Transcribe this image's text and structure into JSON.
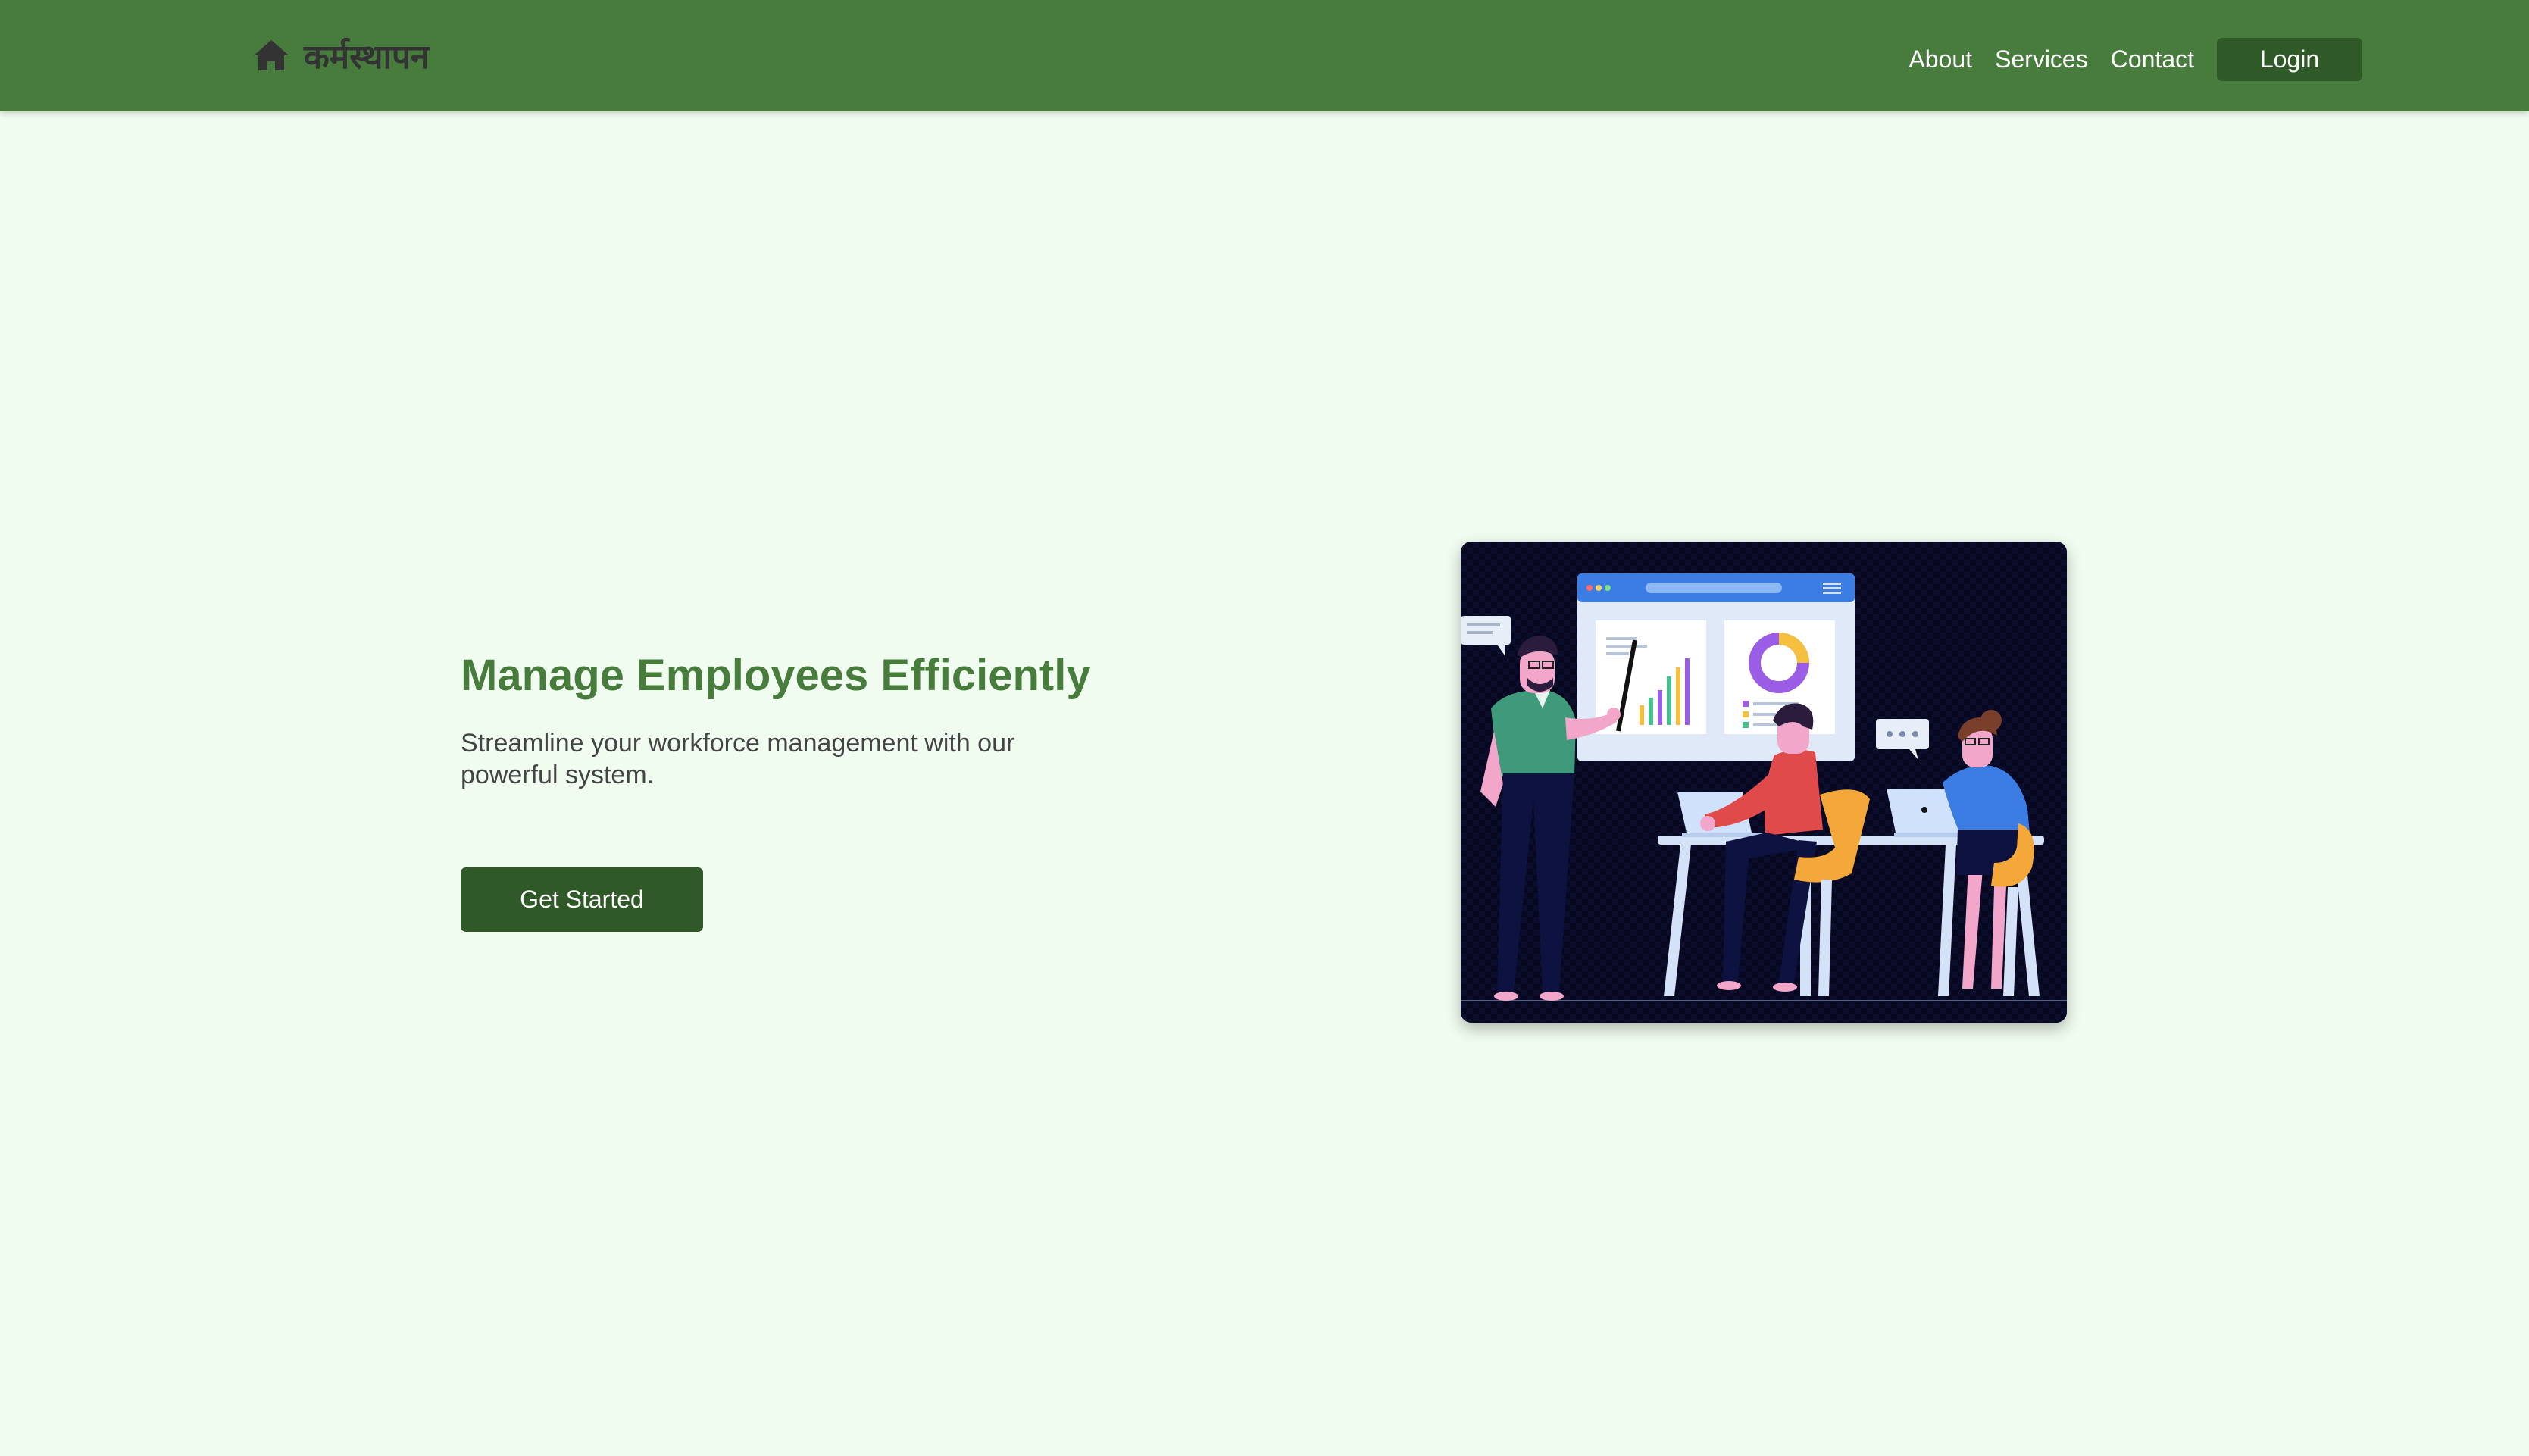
{
  "brand": {
    "name": "कर्मस्थापन",
    "icon": "home-icon"
  },
  "nav": {
    "links": [
      "About",
      "Services",
      "Contact"
    ],
    "login_label": "Login"
  },
  "hero": {
    "title": "Manage Employees Efficiently",
    "subtitle": "Streamline your workforce management with our powerful system.",
    "cta_label": "Get Started"
  },
  "colors": {
    "nav_background": "#477c3d",
    "page_background": "#f1fcf0",
    "button_background": "#2f5a27",
    "title_color": "#477c3d"
  }
}
